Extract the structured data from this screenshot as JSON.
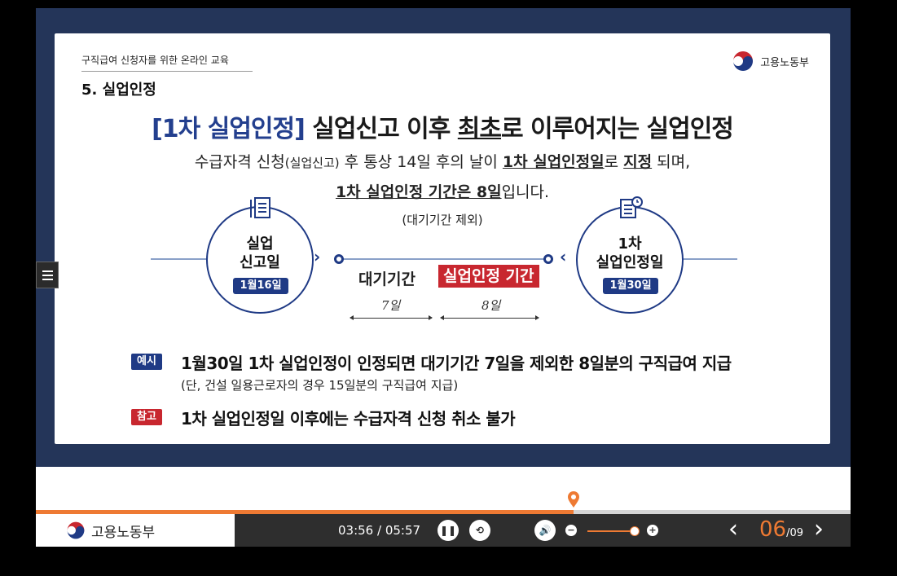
{
  "slide": {
    "course_title": "구직급여 신청자를 위한 온라인 교육",
    "section_title": "5. 실업인정",
    "ministry": "고용노동부",
    "headline_tag": "[1차 실업인정]",
    "headline_rest_a": "실업신고 이후 ",
    "headline_emph": "최초",
    "headline_rest_b": "로 이루어지는 실업인정",
    "line1_a": "수급자격 신청",
    "line1_paren": "(실업신고)",
    "line1_b": " 후 통상 14일 후의 날이 ",
    "line1_bold": "1차 실업인정일",
    "line1_c": "로 ",
    "line1_bold2": "지정",
    "line1_d": " 되며,",
    "line2_bold": "1차 실업인정 기간은 8일",
    "line2_rest": "입니다.",
    "note": "(대기기간 제외)",
    "left_circle": {
      "line1": "실업",
      "line2": "신고일",
      "date": "1월16일"
    },
    "right_circle": {
      "line1": "1차",
      "line2": "실업인정일",
      "date": "1월30일"
    },
    "waiting_label": "대기기간",
    "period_label": "실업인정 기간",
    "waiting_days": "7일",
    "period_days": "8일",
    "example_tag": "예시",
    "example_text": "1월30일 1차 실업인정이 인정되면 대기기간 7일을 제외한 8일분의 구직급여 지급",
    "example_sub": "(단, 건설 일용근로자의 경우 15일분의 구직급여 지급)",
    "note_tag": "참고",
    "note_text": "1차 실업인정일 이후에는 수급자격 신청 취소 불가"
  },
  "player": {
    "logo_text": "고용노동부",
    "time_current": "03:56",
    "time_sep": " / ",
    "time_total": "05:57",
    "progress_fraction": 0.66,
    "volume_fraction": 0.98,
    "page_current": "06",
    "page_total": "/09",
    "icons": [
      "menu-icon",
      "pause-icon",
      "replay-icon",
      "volume-icon",
      "volume-down-icon",
      "volume-up-icon",
      "prev-icon",
      "next-icon"
    ],
    "accent_color": "#ee7a33"
  }
}
